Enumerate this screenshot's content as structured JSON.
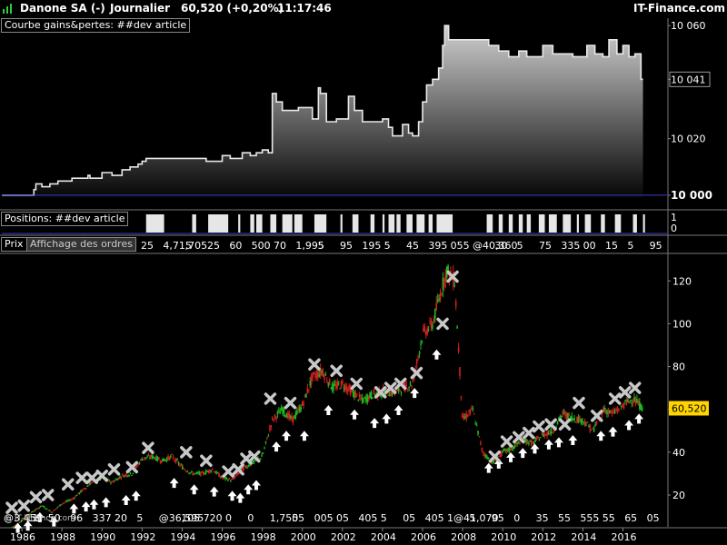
{
  "header": {
    "instrument": "Danone SA (-)",
    "period": "Journalier",
    "price": "60,520 (+0,20%)",
    "time": "11:17:46",
    "site": "IT-Finance.com"
  },
  "colors": {
    "background": "#000000",
    "up_candle": "#1fb81f",
    "down_candle": "#d42020",
    "equity_line": "#e8e8e8",
    "baseline": "#3a3ad0",
    "price_tag": "#ffd400",
    "position_bar": "#e6e6e6",
    "buy_marker": "#ffffff",
    "sell_marker": "#c8c8c8"
  },
  "panels": {
    "equity_label": "Courbe gains&pertes: ##dev article",
    "positions_label": "Positions: ##dev article",
    "price_label": "Prix",
    "orders_label": "Affichage des ordres",
    "watermark": "© IT-Finance.com"
  },
  "order_strips": {
    "top": [
      "25",
      "4,715",
      ",705",
      "25",
      "60",
      "500",
      "70",
      "1,995",
      "5",
      "95",
      "195",
      "5",
      "45",
      "395",
      "055",
      "@40,360",
      "30",
      "5",
      "75",
      "335",
      "00",
      "15",
      "5",
      "95"
    ],
    "bottom": [
      "@3,459",
      "11",
      "50",
      "96",
      "337",
      "20",
      "5",
      "@36,595",
      "105",
      "720",
      "0",
      "0",
      "1,755",
      "05",
      "005",
      "05",
      "405",
      "5",
      "05",
      "405",
      "1@41,070",
      "5",
      "95",
      "0",
      "35",
      "55",
      "555",
      "55",
      "65",
      "05"
    ]
  },
  "chart_data": [
    {
      "type": "area",
      "title": "Courbe gains&pertes: ##dev article",
      "x": [
        1985.0,
        1985.4,
        1985.6,
        1986.6,
        1986.7,
        1987.0,
        1987.4,
        1987.8,
        1988.5,
        1989.3,
        1989.4,
        1990.0,
        1990.5,
        1991.0,
        1991.4,
        1991.8,
        1992.0,
        1992.2,
        1993.5,
        1994.6,
        1995.2,
        1996.0,
        1996.4,
        1997.0,
        1997.4,
        1997.7,
        1998.0,
        1998.3,
        1998.5,
        1998.7,
        1999.0,
        1999.8,
        2000.5,
        2000.8,
        2000.9,
        2001.2,
        2001.7,
        2002.3,
        2002.6,
        2003.0,
        2003.4,
        2004.0,
        2004.3,
        2004.5,
        2005.0,
        2005.3,
        2005.5,
        2005.8,
        2006.0,
        2006.2,
        2006.5,
        2006.8,
        2007.0,
        2007.1,
        2007.3,
        2008.0,
        2009.0,
        2009.3,
        2009.8,
        2010.3,
        2010.8,
        2011.2,
        2011.6,
        2012.0,
        2012.5,
        2013.0,
        2013.5,
        2014.2,
        2014.6,
        2015.0,
        2015.3,
        2015.7,
        2016.0,
        2016.3,
        2016.6,
        2016.9,
        2017.0
      ],
      "y": [
        10000,
        10000,
        10000,
        10002,
        10004,
        10003,
        10004,
        10005,
        10006,
        10007,
        10006,
        10008,
        10007,
        10009,
        10010,
        10011,
        10012,
        10013,
        10013,
        10013,
        10012,
        10014,
        10013,
        10015,
        10014,
        10015,
        10016,
        10015,
        10036,
        10033,
        10030,
        10031,
        10027,
        10038,
        10036,
        10026,
        10027,
        10035,
        10030,
        10026,
        10026,
        10027,
        10024,
        10021,
        10025,
        10022,
        10021,
        10026,
        10033,
        10039,
        10041,
        10045,
        10053,
        10060,
        10055,
        10055,
        10055,
        10053,
        10051,
        10049,
        10051,
        10049,
        10049,
        10053,
        10050,
        10050,
        10049,
        10053,
        10050,
        10049,
        10055,
        10050,
        10053,
        10049,
        10050,
        10041,
        10041
      ],
      "yticks": [
        "10 000",
        "10 020",
        "10 041",
        "10 060"
      ],
      "ylim": [
        9999,
        10062
      ]
    },
    {
      "type": "bar",
      "title": "Positions: ##dev article",
      "intervals": [
        [
          1992.2,
          1993.1
        ],
        [
          1994.5,
          1994.7
        ],
        [
          1995.3,
          1996.3
        ],
        [
          1996.8,
          1996.9
        ],
        [
          1997.4,
          1997.6
        ],
        [
          1997.7,
          1998.0
        ],
        [
          1998.4,
          1998.7
        ],
        [
          1999.0,
          1999.5
        ],
        [
          1999.6,
          2000.0
        ],
        [
          2000.6,
          2001.2
        ],
        [
          2001.9,
          2002.0
        ],
        [
          2002.5,
          2002.8
        ],
        [
          2003.4,
          2003.6
        ],
        [
          2004.0,
          2004.1
        ],
        [
          2004.3,
          2004.6
        ],
        [
          2004.7,
          2004.9
        ],
        [
          2005.2,
          2005.5
        ],
        [
          2005.7,
          2006.1
        ],
        [
          2006.3,
          2006.5
        ],
        [
          2006.7,
          2007.5
        ],
        [
          2009.2,
          2009.5
        ],
        [
          2009.8,
          2010.0
        ],
        [
          2010.3,
          2010.5
        ],
        [
          2010.8,
          2011.0
        ],
        [
          2011.2,
          2011.4
        ],
        [
          2011.8,
          2012.1
        ],
        [
          2012.3,
          2012.7
        ],
        [
          2013.0,
          2013.4
        ],
        [
          2013.7,
          2013.8
        ],
        [
          2014.1,
          2014.4
        ],
        [
          2014.9,
          2015.1
        ],
        [
          2015.6,
          2015.9
        ],
        [
          2016.5,
          2016.7
        ],
        [
          2017.0,
          2017.1
        ]
      ],
      "yticks": [
        "1",
        "0"
      ]
    },
    {
      "type": "candlestick",
      "title": "Prix",
      "x": [
        1985.5,
        1986.0,
        1986.5,
        1987.0,
        1987.5,
        1988.0,
        1988.5,
        1989.0,
        1989.5,
        1990.0,
        1990.5,
        1991.0,
        1991.5,
        1992.0,
        1992.5,
        1993.0,
        1993.5,
        1994.0,
        1994.5,
        1995.0,
        1995.5,
        1996.0,
        1996.5,
        1997.0,
        1997.5,
        1998.0,
        1998.5,
        1999.0,
        1999.5,
        2000.0,
        2000.5,
        2001.0,
        2001.5,
        2002.0,
        2002.5,
        2003.0,
        2003.5,
        2004.0,
        2004.5,
        2005.0,
        2005.5,
        2006.0,
        2006.5,
        2007.0,
        2007.2,
        2007.6,
        2008.0,
        2008.5,
        2009.0,
        2009.5,
        2010.0,
        2010.5,
        2011.0,
        2011.5,
        2012.0,
        2012.5,
        2013.0,
        2013.5,
        2014.0,
        2014.5,
        2015.0,
        2015.5,
        2016.0,
        2016.5,
        2017.0
      ],
      "close": [
        5,
        8,
        12,
        15,
        12,
        16,
        18,
        22,
        26,
        28,
        26,
        29,
        30,
        37,
        38,
        36,
        38,
        33,
        30,
        30,
        32,
        28,
        27,
        32,
        35,
        38,
        55,
        60,
        55,
        62,
        75,
        78,
        70,
        72,
        68,
        64,
        67,
        68,
        68,
        70,
        72,
        95,
        100,
        118,
        125,
        120,
        55,
        60,
        40,
        35,
        40,
        42,
        46,
        44,
        48,
        50,
        58,
        56,
        55,
        50,
        60,
        58,
        62,
        65,
        60.52
      ],
      "yticks": [
        20,
        40,
        60,
        80,
        100,
        120
      ],
      "ylim": [
        6,
        132
      ],
      "last_price": "60,520",
      "buy_marks": [
        [
          1985.8,
          7
        ],
        [
          1986.3,
          8
        ],
        [
          1986.9,
          12
        ],
        [
          1987.6,
          10
        ],
        [
          1988.6,
          16
        ],
        [
          1989.2,
          17
        ],
        [
          1989.6,
          18
        ],
        [
          1990.2,
          19
        ],
        [
          1991.2,
          20
        ],
        [
          1991.7,
          22
        ],
        [
          1993.6,
          28
        ],
        [
          1994.6,
          25
        ],
        [
          1995.6,
          24
        ],
        [
          1996.5,
          22
        ],
        [
          1996.9,
          21
        ],
        [
          1997.3,
          25
        ],
        [
          1997.7,
          27
        ],
        [
          1998.7,
          45
        ],
        [
          1999.2,
          50
        ],
        [
          2000.1,
          50
        ],
        [
          2001.3,
          62
        ],
        [
          2002.6,
          60
        ],
        [
          2003.6,
          56
        ],
        [
          2004.2,
          58
        ],
        [
          2004.8,
          62
        ],
        [
          2005.6,
          70
        ],
        [
          2006.7,
          88
        ],
        [
          2009.3,
          35
        ],
        [
          2009.8,
          37
        ],
        [
          2010.4,
          40
        ],
        [
          2011.0,
          42
        ],
        [
          2011.6,
          44
        ],
        [
          2012.3,
          46
        ],
        [
          2012.8,
          47
        ],
        [
          2013.5,
          48
        ],
        [
          2014.9,
          50
        ],
        [
          2015.5,
          52
        ],
        [
          2016.3,
          55
        ],
        [
          2016.8,
          58
        ]
      ],
      "sell_marks": [
        [
          1985.5,
          14
        ],
        [
          1986.1,
          15
        ],
        [
          1986.7,
          19
        ],
        [
          1987.3,
          20
        ],
        [
          1988.3,
          25
        ],
        [
          1989.0,
          28
        ],
        [
          1989.5,
          28
        ],
        [
          1990.0,
          29
        ],
        [
          1990.6,
          32
        ],
        [
          1991.5,
          33
        ],
        [
          1992.3,
          42
        ],
        [
          1994.2,
          40
        ],
        [
          1995.2,
          36
        ],
        [
          1996.3,
          31
        ],
        [
          1996.8,
          32
        ],
        [
          1997.2,
          37
        ],
        [
          1997.6,
          38
        ],
        [
          1998.4,
          65
        ],
        [
          1999.4,
          63
        ],
        [
          2000.6,
          81
        ],
        [
          2001.7,
          78
        ],
        [
          2002.7,
          72
        ],
        [
          2003.9,
          68
        ],
        [
          2004.4,
          70
        ],
        [
          2004.9,
          72
        ],
        [
          2005.7,
          77
        ],
        [
          2007.0,
          100
        ],
        [
          2007.5,
          122
        ],
        [
          2009.6,
          38
        ],
        [
          2010.2,
          45
        ],
        [
          2010.8,
          47
        ],
        [
          2011.3,
          49
        ],
        [
          2011.8,
          52
        ],
        [
          2012.4,
          53
        ],
        [
          2013.1,
          53
        ],
        [
          2013.8,
          63
        ],
        [
          2014.7,
          57
        ],
        [
          2015.6,
          65
        ],
        [
          2016.1,
          68
        ],
        [
          2016.6,
          70
        ]
      ]
    }
  ],
  "x_axis": {
    "labels": [
      "1986",
      "1988",
      "1990",
      "1992",
      "1994",
      "1996",
      "1998",
      "2000",
      "2002",
      "2004",
      "2006",
      "2008",
      "2010",
      "2012",
      "2014",
      "2016"
    ],
    "xlim": [
      1985.0,
      2018.2
    ]
  }
}
